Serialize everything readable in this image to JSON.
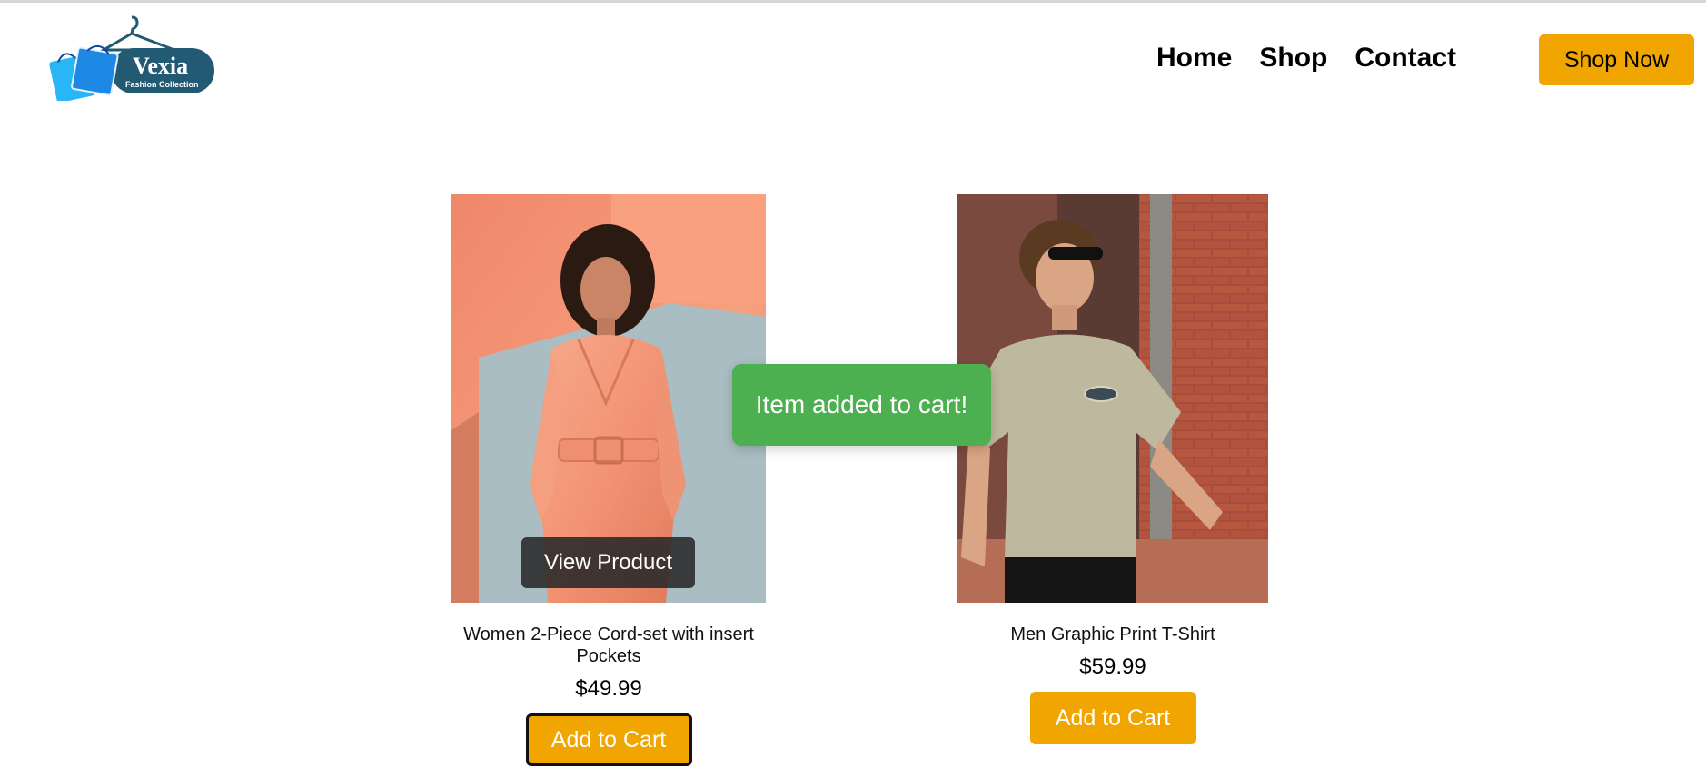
{
  "brand": {
    "name": "Vexia",
    "tagline": "Fashion Collection"
  },
  "nav": {
    "items": [
      {
        "label": "Home"
      },
      {
        "label": "Shop"
      },
      {
        "label": "Contact"
      }
    ],
    "cta_label": "Shop Now"
  },
  "products": [
    {
      "name": "Women 2-Piece Cord-set with insert Pockets",
      "price": "$49.99",
      "add_label": "Add to Cart",
      "overlay_label": "View Product",
      "image_icon": "woman-satin-jumpsuit-photo"
    },
    {
      "name": "Men Graphic Print T-Shirt",
      "price": "$59.99",
      "add_label": "Add to Cart",
      "image_icon": "man-tshirt-photo"
    }
  ],
  "toast": {
    "message": "Item added to cart!"
  },
  "colors": {
    "accent": "#f0a500",
    "toast": "#4caf50",
    "brand_dark": "#235a73",
    "brand_blue": "#1e88e5"
  }
}
